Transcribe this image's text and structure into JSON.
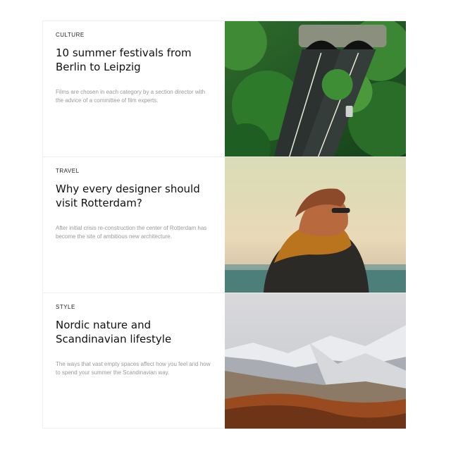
{
  "articles": [
    {
      "category": "Culture",
      "title": "10 summer festivals from Berlin to Leipzig",
      "description": "Films are chosen in each category by a section director with the advice of a committee of film experts.",
      "image": "forest-tunnel-road-photo"
    },
    {
      "category": "Travel",
      "title": "Why every designer should visit Rotterdam?",
      "description": "After initial crisis re-construction the center of Rotterdam has become the site of ambitious new architecture.",
      "image": "person-scarf-sea-photo"
    },
    {
      "category": "Style",
      "title": "Nordic nature and Scandinavian lifestyle",
      "description": "The ways that vast empty spaces affect how you feel and how to spend your summer the Scandinavian way.",
      "image": "snowy-mountain-valley-photo"
    }
  ]
}
